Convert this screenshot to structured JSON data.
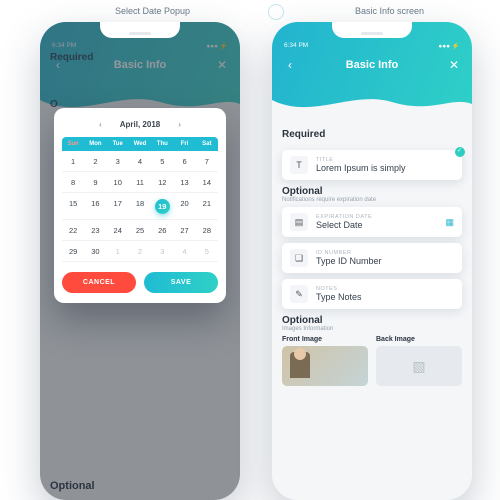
{
  "captions": {
    "left": "Select Date Popup",
    "right": "Basic Info screen"
  },
  "status": {
    "time": "6:34 PM"
  },
  "header": {
    "title": "Basic Info"
  },
  "popup": {
    "month_label": "April, 2018",
    "dow": [
      "Sun",
      "Mon",
      "Tue",
      "Wed",
      "Thu",
      "Fri",
      "Sat"
    ],
    "cells": [
      {
        "n": "1"
      },
      {
        "n": "2"
      },
      {
        "n": "3"
      },
      {
        "n": "4"
      },
      {
        "n": "5"
      },
      {
        "n": "6"
      },
      {
        "n": "7"
      },
      {
        "n": "8"
      },
      {
        "n": "9"
      },
      {
        "n": "10"
      },
      {
        "n": "11"
      },
      {
        "n": "12"
      },
      {
        "n": "13"
      },
      {
        "n": "14"
      },
      {
        "n": "15"
      },
      {
        "n": "16"
      },
      {
        "n": "17"
      },
      {
        "n": "18"
      },
      {
        "n": "19",
        "sel": true
      },
      {
        "n": "20"
      },
      {
        "n": "21"
      },
      {
        "n": "22"
      },
      {
        "n": "23"
      },
      {
        "n": "24"
      },
      {
        "n": "25"
      },
      {
        "n": "26"
      },
      {
        "n": "27"
      },
      {
        "n": "28"
      },
      {
        "n": "29"
      },
      {
        "n": "30"
      },
      {
        "n": "1",
        "mute": true
      },
      {
        "n": "2",
        "mute": true
      },
      {
        "n": "3",
        "mute": true
      },
      {
        "n": "4",
        "mute": true
      },
      {
        "n": "5",
        "mute": true
      }
    ],
    "cancel": "CANCEL",
    "save": "SAVE"
  },
  "left_bg": {
    "required": "Required",
    "optional_letter": "O",
    "optional_bottom": "Optional"
  },
  "sections": {
    "required": {
      "title": "Required",
      "sub": ""
    },
    "optional1": {
      "title": "Optional",
      "sub": "Notifications require expiration date"
    },
    "optional2": {
      "title": "Optional",
      "sub": "Images Information"
    }
  },
  "fields": {
    "title": {
      "label": "TITLE",
      "value": "Lorem Ipsum is simply",
      "icon": "text-icon"
    },
    "date": {
      "label": "EXPIRATION DATE",
      "value": "Select Date",
      "icon": "calendar-icon"
    },
    "id": {
      "label": "ID NUMBER",
      "value": "Type ID Number",
      "icon": "id-icon"
    },
    "notes": {
      "label": "NOTES",
      "value": "Type Notes",
      "icon": "notes-icon"
    }
  },
  "images": {
    "front": "Front Image",
    "back": "Back Image"
  },
  "icons": {
    "back": "‹",
    "close": "✕",
    "prev": "‹",
    "next": "›",
    "text": "T",
    "calendar": "▤",
    "id": "❏",
    "notes": "✎",
    "cal_small": "▦",
    "placeholder": "▧"
  },
  "colors": {
    "accent": "#1fbcd3",
    "accent2": "#2fd0c7",
    "danger": "#ff4b3e"
  }
}
